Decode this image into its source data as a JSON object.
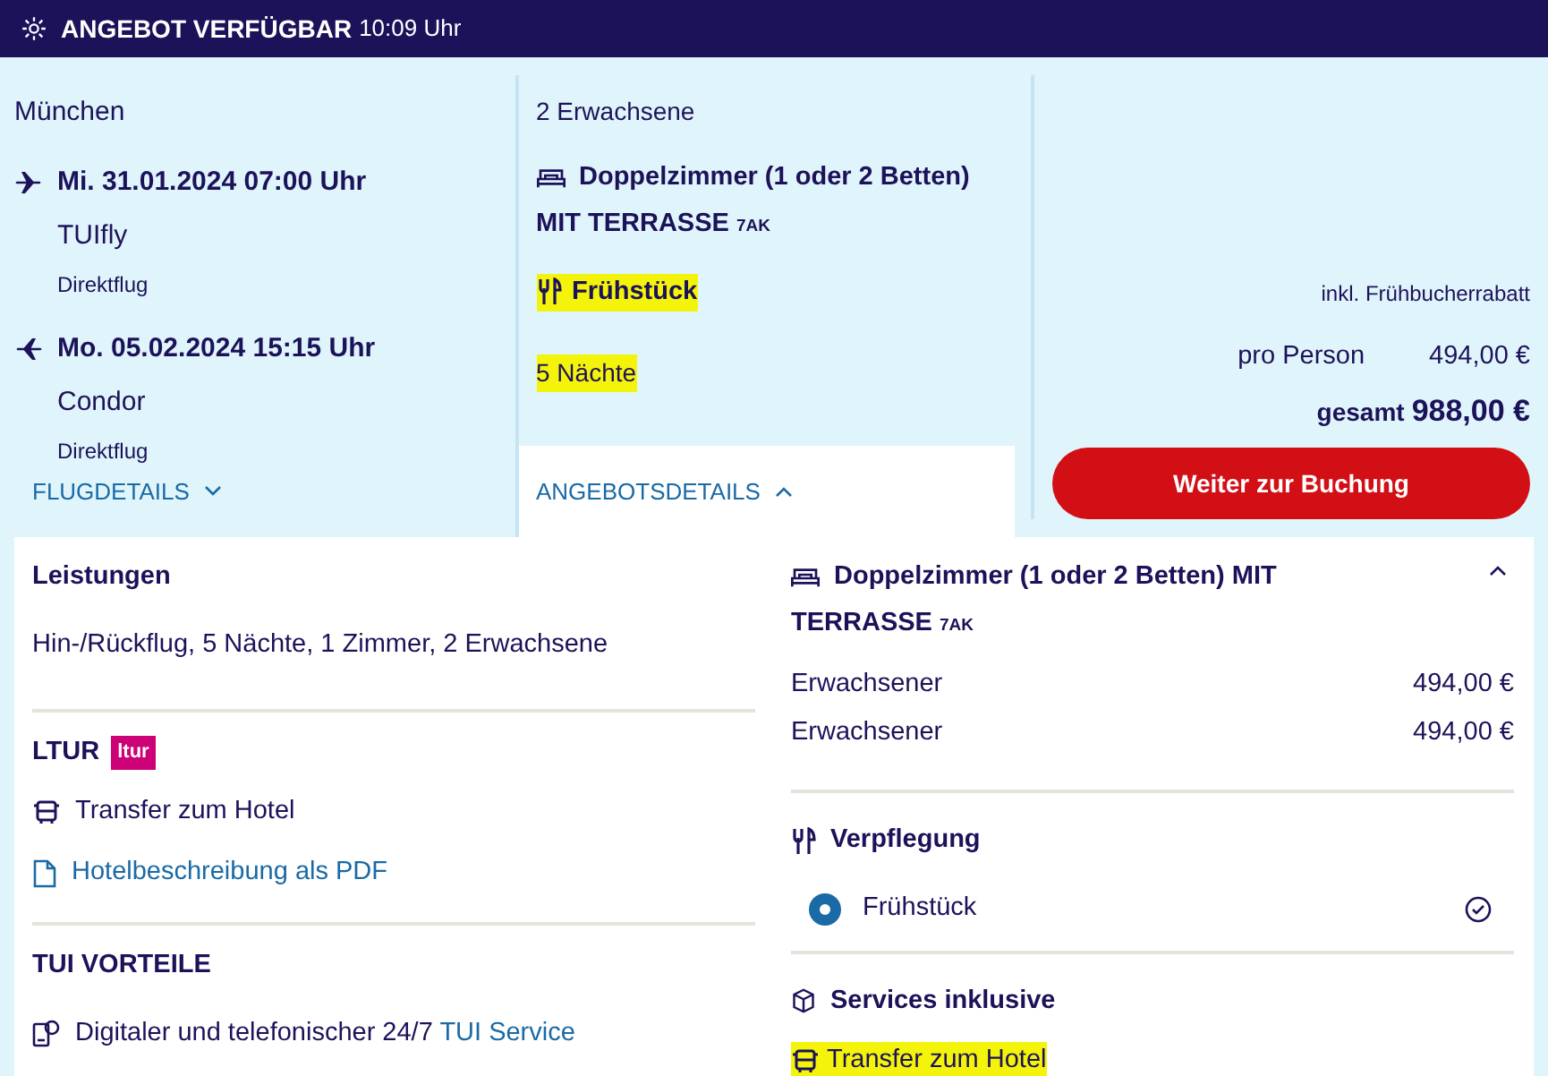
{
  "banner": {
    "title": "ANGEBOT VERFÜGBAR",
    "time": "10:09 Uhr"
  },
  "flights": {
    "origin": "München",
    "legs": [
      {
        "kind": "outbound",
        "datetime": "Mi. 31.01.2024 07:00 Uhr",
        "airline": "TUIfly",
        "type": "Direktflug"
      },
      {
        "kind": "return",
        "datetime": "Mo. 05.02.2024 15:15 Uhr",
        "airline": "Condor",
        "type": "Direktflug"
      }
    ],
    "details_toggle": {
      "label": "FLUGDETAILS",
      "expanded": false
    }
  },
  "offer": {
    "travellers": "2 Erwachsene",
    "room": {
      "name": "Doppelzimmer (1 oder 2 Betten)",
      "name_rest": "MIT TERRASSE",
      "code": "7AK"
    },
    "board": {
      "label": "Frühstück",
      "highlighted": true
    },
    "nights": {
      "label": "5 Nächte",
      "highlighted": true
    },
    "details_tab": {
      "label": "ANGEBOTSDETAILS",
      "expanded": true
    }
  },
  "price": {
    "note": "inkl. Frühbucherrabatt",
    "per_person_label": "pro Person",
    "per_person_value": "494,00 €",
    "total_label": "gesamt",
    "total_value": "988,00 €",
    "button": "Weiter zur Buchung"
  },
  "details_left": [
    {
      "kind": "text",
      "title": "Leistungen",
      "text": "Hin-/Rückflug, 5 Nächte, 1 Zimmer, 2 Erwachsene"
    },
    {
      "kind": "ltur",
      "title": "LTUR",
      "badge": "ltur",
      "items": [
        {
          "kind": "bus",
          "label": "Transfer zum Hotel",
          "link": false
        },
        {
          "kind": "document",
          "label": "Hotelbeschreibung als PDF",
          "link": true
        }
      ]
    },
    {
      "kind": "service",
      "title": "TUI VORTEILE",
      "text": "Digitaler und telefonischer 24/7",
      "link": "TUI Service"
    }
  ],
  "details_right": {
    "room": {
      "name": "Doppelzimmer (1 oder 2 Betten) MIT",
      "name_rest": "TERRASSE",
      "code": "7AK",
      "expanded": true
    },
    "prices": [
      {
        "label": "Erwachsener",
        "value": "494,00 €"
      },
      {
        "label": "Erwachsener",
        "value": "494,00 €"
      }
    ],
    "board": {
      "title": "Verpflegung",
      "options": [
        {
          "label": "Frühstück",
          "selected": true,
          "included": true
        }
      ]
    },
    "services": {
      "title": "Services inklusive",
      "items": [
        {
          "label": "Transfer zum Hotel",
          "highlighted": true
        }
      ]
    }
  }
}
